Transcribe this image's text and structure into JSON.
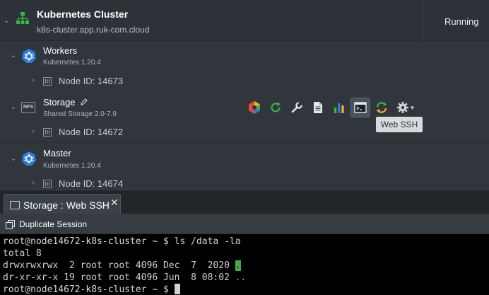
{
  "environment": {
    "title": "Kubernetes Cluster",
    "domain": "k8s-cluster.app.ruk-com.cloud",
    "status": "Running"
  },
  "groups": [
    {
      "name": "Workers",
      "version": "Kubernetes 1.20.4",
      "node_id": "Node ID: 14673",
      "icon": "kubernetes-icon"
    },
    {
      "name": "Storage",
      "version": "Shared Storage 2.0-7.9",
      "node_id": "Node ID: 14672",
      "icon": "nfs-icon",
      "badge": "NFS"
    },
    {
      "name": "Master",
      "version": "Kubernetes 1.20.4",
      "node_id": "Node ID: 14674",
      "icon": "kubernetes-icon"
    }
  ],
  "tools": [
    "addons-icon",
    "restart-icon",
    "config-icon",
    "log-icon",
    "stats-icon",
    "web-ssh-icon",
    "redeploy-icon",
    "settings-icon"
  ],
  "tooltip": "Web SSH",
  "tab": {
    "label": "Storage : Web SSH",
    "close": "✕"
  },
  "toolbar": {
    "duplicate_label": "Duplicate Session"
  },
  "terminal": {
    "prompt": "root@node14672-k8s-cluster ~ $",
    "command": " ls /data -la",
    "total": "total 8",
    "line1": "drwxrwxrwx  2 root root 4096 Dec  7  2020 ",
    "line1_name": ".",
    "line2": "dr-xr-xr-x 19 root root 4096 Jun  8 08:02 ",
    "line2_name": ".."
  },
  "colors": {
    "accent_blue": "#2f7bd8",
    "green": "#4aa84a",
    "terminal_bg": "#000000"
  }
}
